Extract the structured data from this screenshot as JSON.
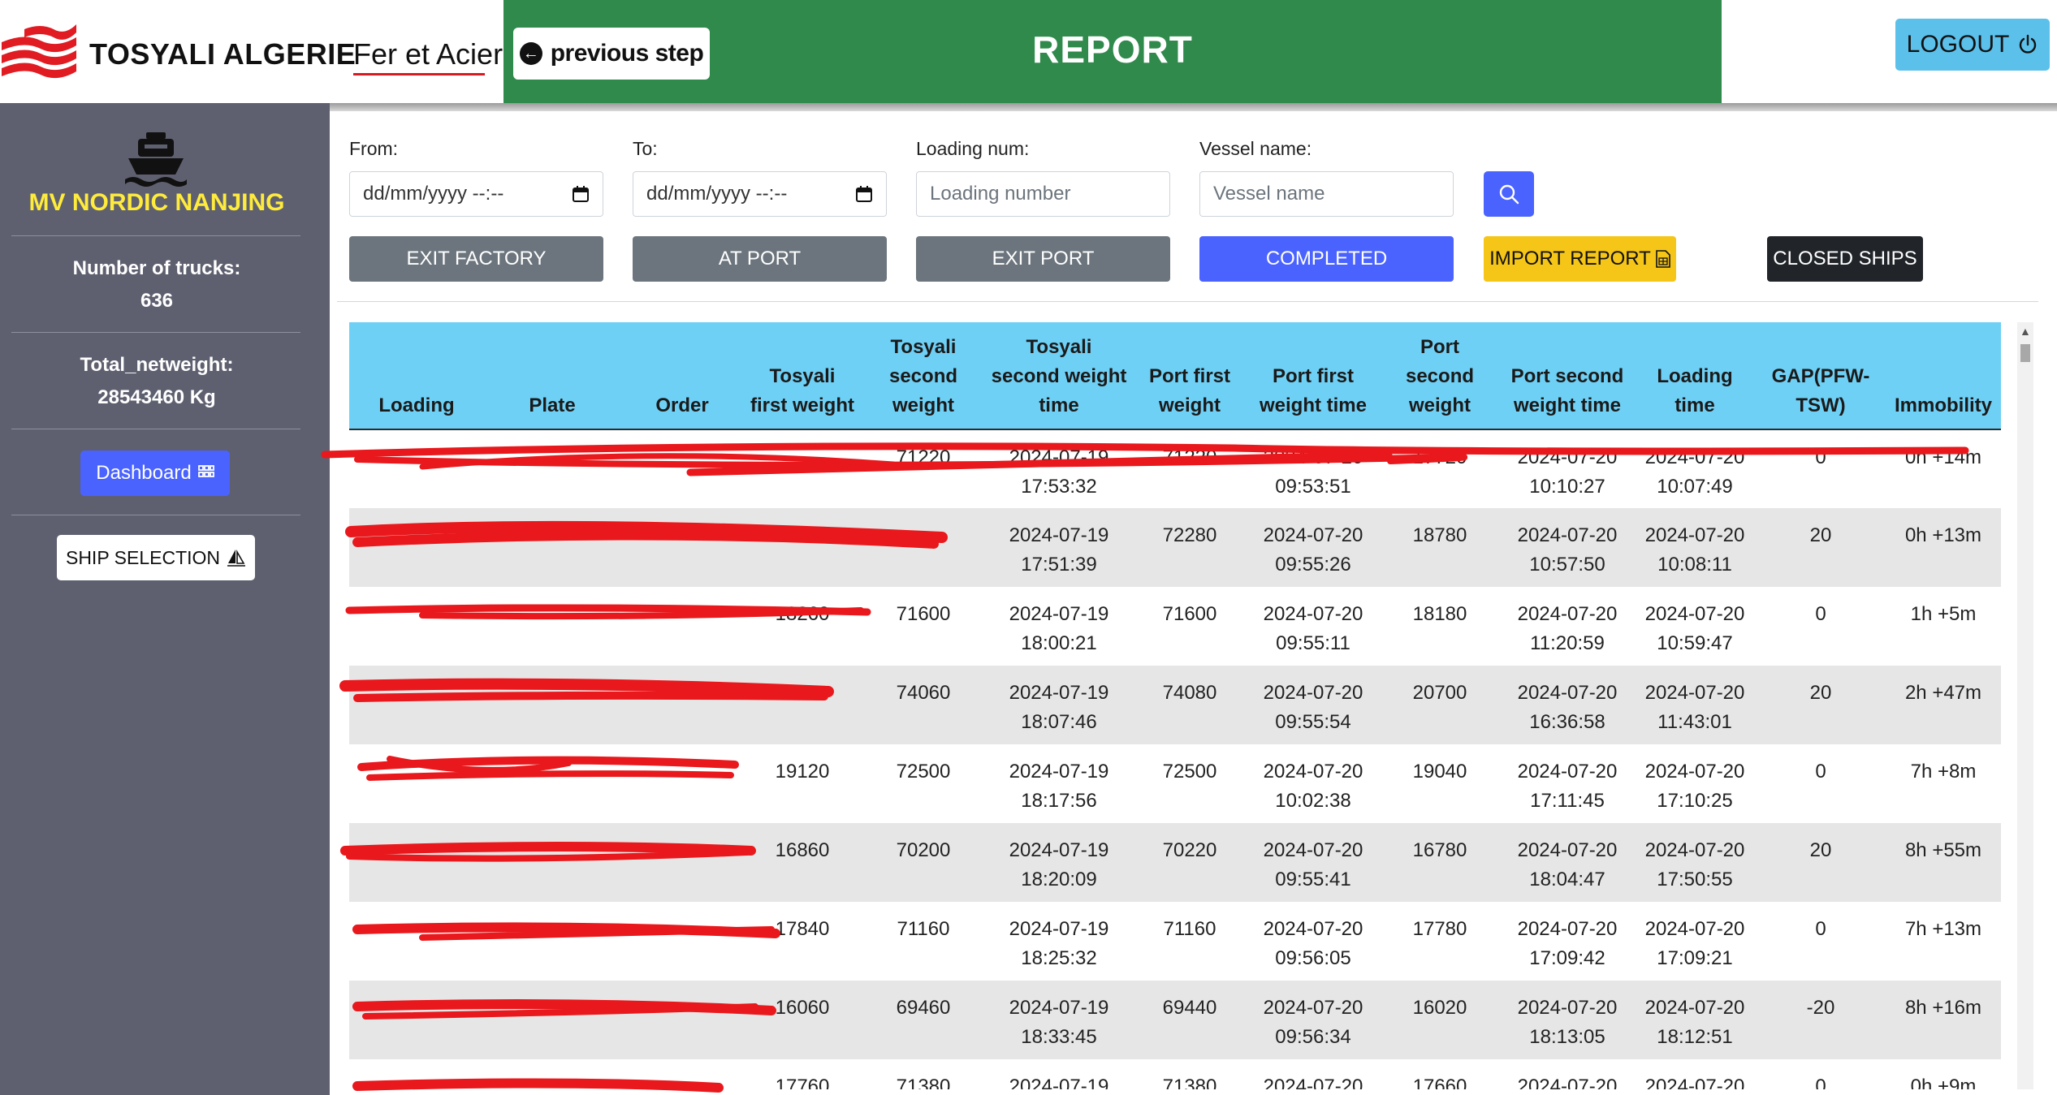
{
  "header": {
    "brand_name": "TOSYALI ALGERIE",
    "brand_sub": "Fer et Acier",
    "previous_step_label": "previous step",
    "title": "REPORT",
    "logout_label": "LOGOUT"
  },
  "sidebar": {
    "ship_name": "MV NORDIC NANJING",
    "trucks_label": "Number of trucks:",
    "trucks_value": "636",
    "netweight_label": "Total_netweight:",
    "netweight_value": "28543460 Kg",
    "dashboard_label": "Dashboard",
    "ship_selection_label": "SHIP SELECTION"
  },
  "filters": {
    "from_label": "From:",
    "from_value": "dd/mm/yyyy --:--",
    "to_label": "To:",
    "to_value": "dd/mm/yyyy --:--",
    "loading_label": "Loading num:",
    "loading_placeholder": "Loading number",
    "vessel_label": "Vessel name:",
    "vessel_placeholder": "Vessel name"
  },
  "actions": {
    "exit_factory": "EXIT FACTORY",
    "at_port": "AT PORT",
    "exit_port": "EXIT PORT",
    "completed": "COMPLETED",
    "import_report": "IMPORT REPORT",
    "closed_ships": "CLOSED SHIPS"
  },
  "colors": {
    "green_band": "#2f8a4c",
    "sidebar_bg": "#5e6070",
    "ship_name": "#ffeb3b",
    "primary": "#4a63ff",
    "warning": "#f5c518",
    "dark": "#212529",
    "table_header": "#6fd0f5",
    "logout": "#5bc0ea",
    "redaction": "#e8181c"
  },
  "table": {
    "columns": [
      "Loading",
      "Plate",
      "Order",
      "Tosyali first weight",
      "Tosyali second weight",
      "Tosyali second weight time",
      "Port first weight",
      "Port first weight time",
      "Port second weight",
      "Port second weight time",
      "Loading time",
      "GAP(PFW-TSW)",
      "Immobility"
    ],
    "rows": [
      [
        "",
        "",
        "",
        "",
        "71220",
        "2024-07-19 17:53:32",
        "71220",
        "2024-07-20 09:53:51",
        "17720",
        "2024-07-20 10:10:27",
        "2024-07-20 10:07:49",
        "0",
        "0h +14m"
      ],
      [
        "",
        "",
        "",
        "",
        "",
        "2024-07-19 17:51:39",
        "72280",
        "2024-07-20 09:55:26",
        "18780",
        "2024-07-20 10:57:50",
        "2024-07-20 10:08:11",
        "20",
        "0h +13m"
      ],
      [
        "",
        "",
        "",
        "18260",
        "71600",
        "2024-07-19 18:00:21",
        "71600",
        "2024-07-20 09:55:11",
        "18180",
        "2024-07-20 11:20:59",
        "2024-07-20 10:59:47",
        "0",
        "1h +5m"
      ],
      [
        "",
        "",
        "",
        "",
        "74060",
        "2024-07-19 18:07:46",
        "74080",
        "2024-07-20 09:55:54",
        "20700",
        "2024-07-20 16:36:58",
        "2024-07-20 11:43:01",
        "20",
        "2h +47m"
      ],
      [
        "",
        "",
        "",
        "19120",
        "72500",
        "2024-07-19 18:17:56",
        "72500",
        "2024-07-20 10:02:38",
        "19040",
        "2024-07-20 17:11:45",
        "2024-07-20 17:10:25",
        "0",
        "7h +8m"
      ],
      [
        "",
        "",
        "",
        "16860",
        "70200",
        "2024-07-19 18:20:09",
        "70220",
        "2024-07-20 09:55:41",
        "16780",
        "2024-07-20 18:04:47",
        "2024-07-20 17:50:55",
        "20",
        "8h +55m"
      ],
      [
        "",
        "",
        "",
        "17840",
        "71160",
        "2024-07-19 18:25:32",
        "71160",
        "2024-07-20 09:56:05",
        "17780",
        "2024-07-20 17:09:42",
        "2024-07-20 17:09:21",
        "0",
        "7h +13m"
      ],
      [
        "",
        "",
        "",
        "16060",
        "69460",
        "2024-07-19 18:33:45",
        "69440",
        "2024-07-20 09:56:34",
        "16020",
        "2024-07-20 18:13:05",
        "2024-07-20 18:12:51",
        "-20",
        "8h +16m"
      ],
      [
        "",
        "",
        "",
        "17760",
        "71380",
        "2024-07-19",
        "71380",
        "2024-07-20",
        "17660",
        "2024-07-20",
        "2024-07-20",
        "0",
        "0h +9m"
      ]
    ]
  }
}
